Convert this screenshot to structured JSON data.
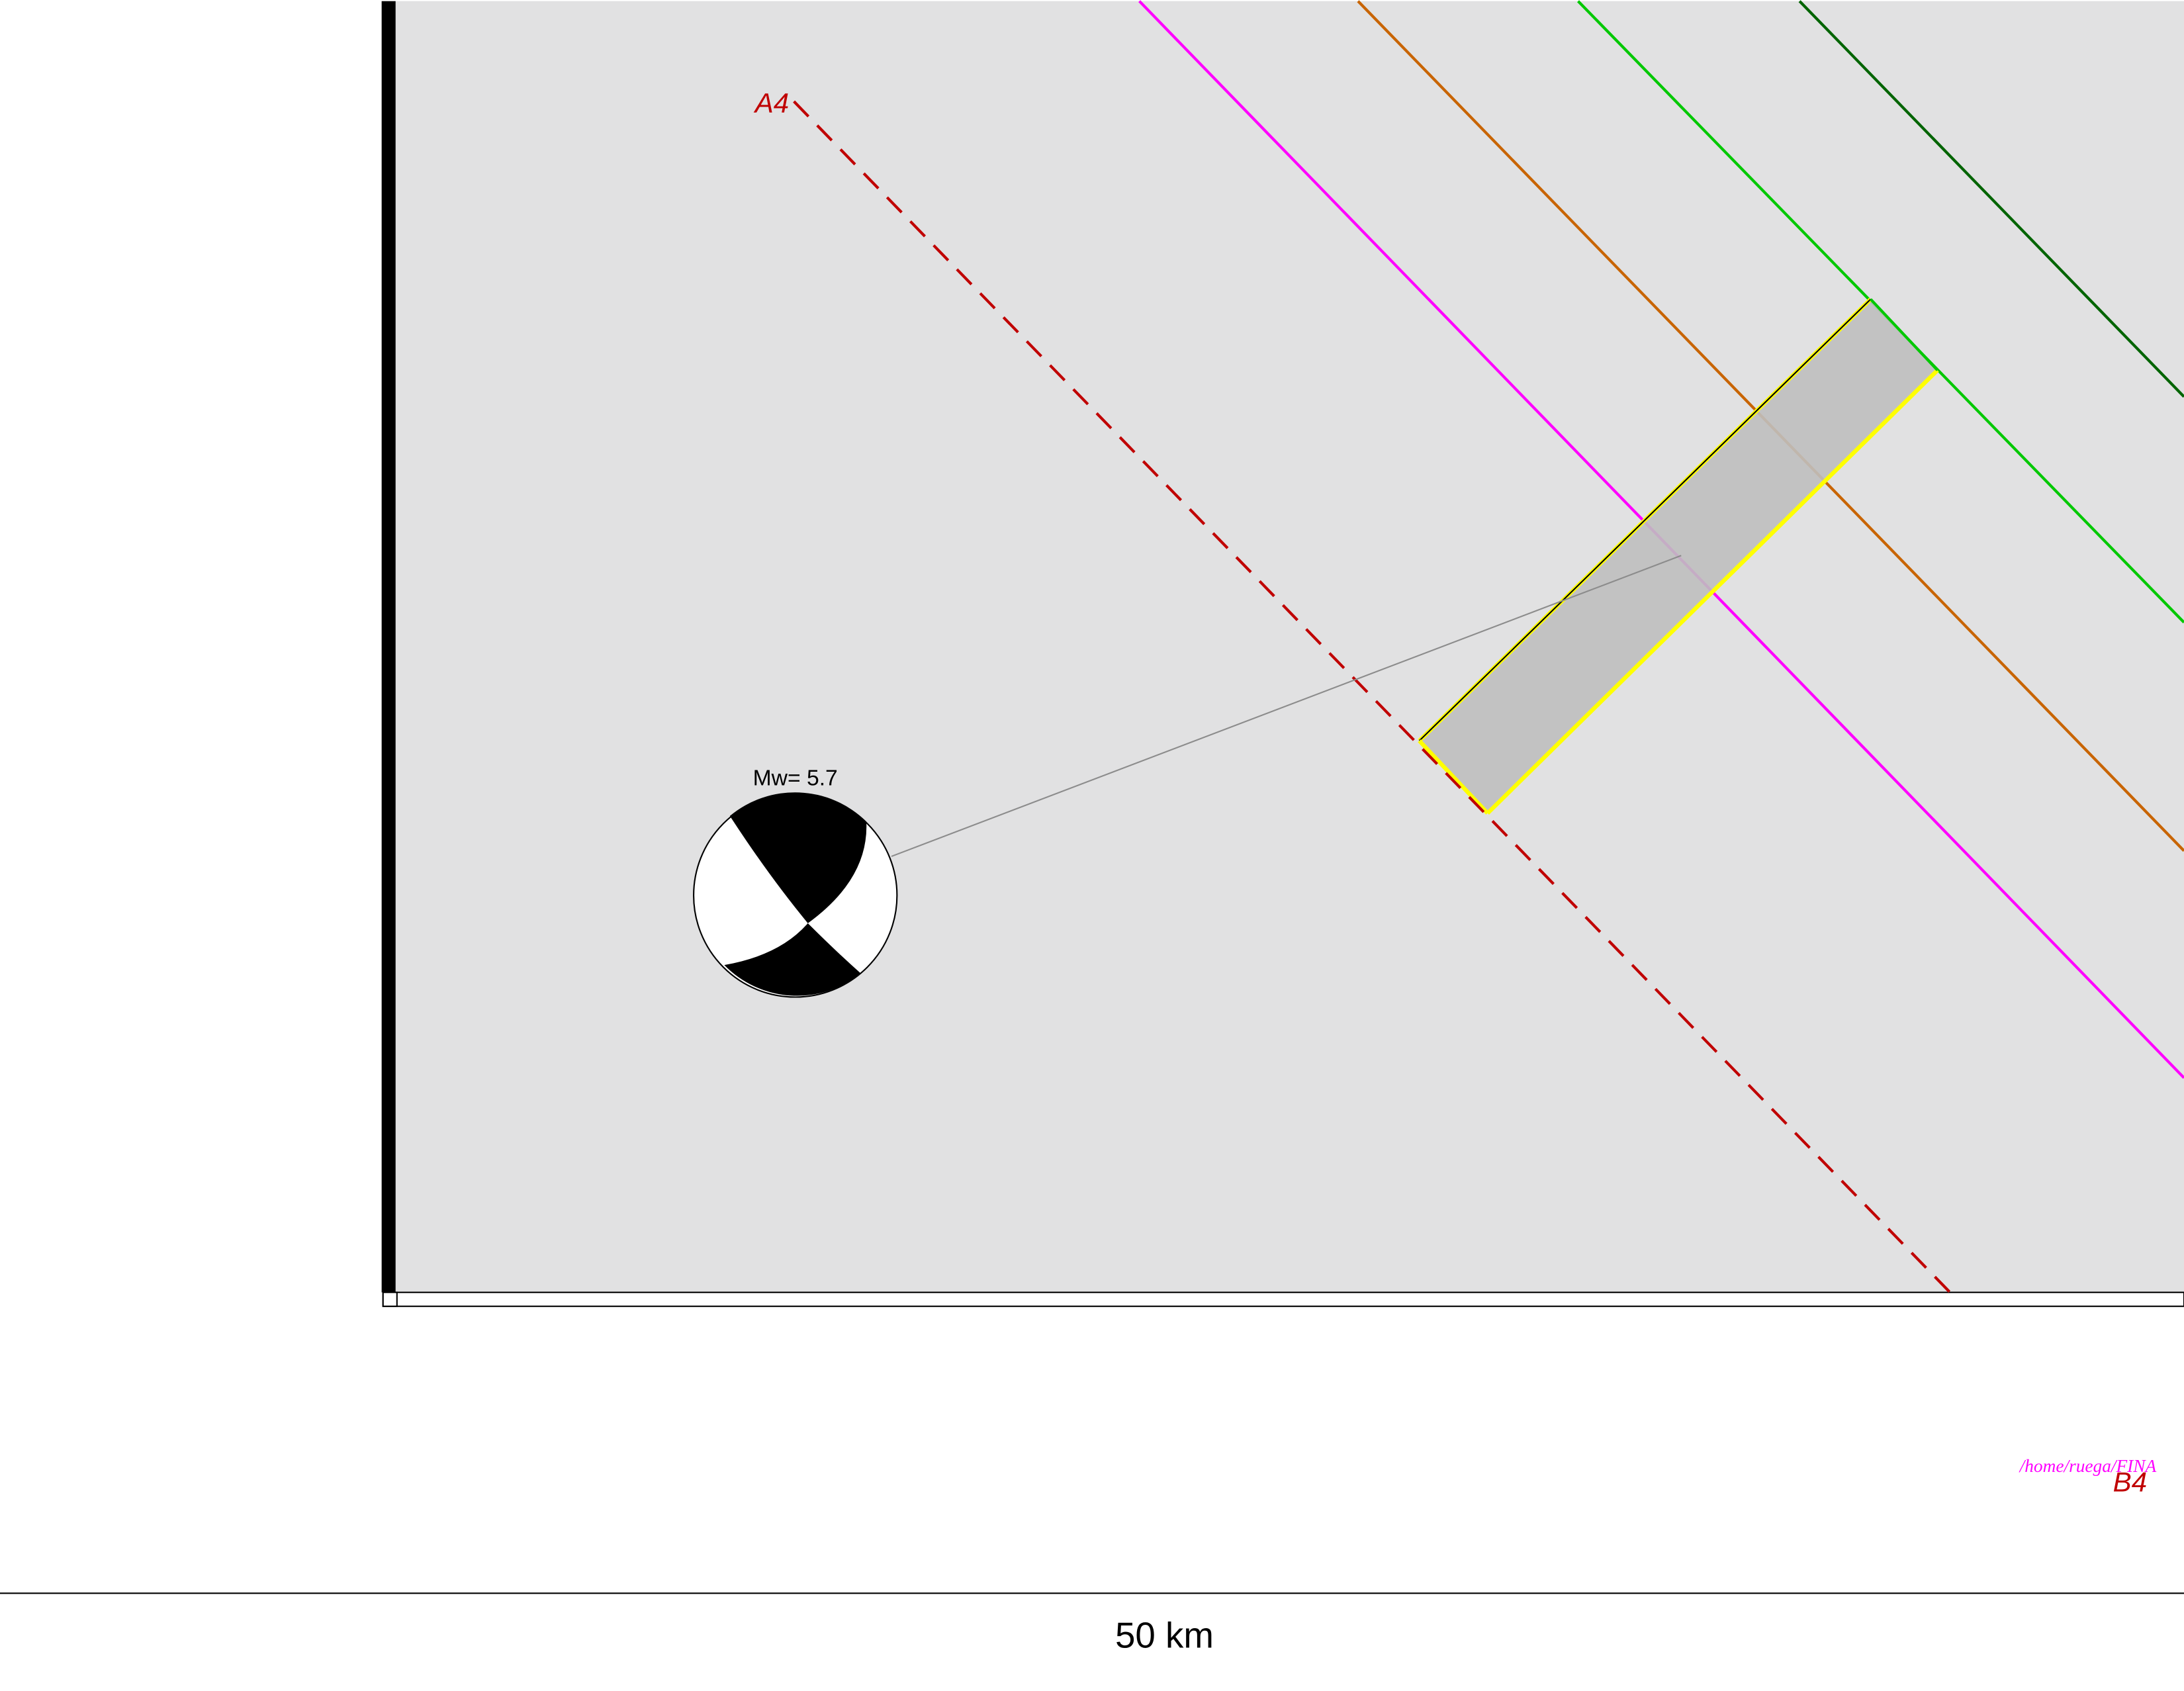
{
  "map": {
    "profile_start_label": "A4",
    "profile_end_label": "B4",
    "magnitude_label": "Mw= 5.7",
    "file_path": "/home/ruega/FINA",
    "scale_label": "50 km"
  },
  "colors": {
    "land": "#e1e1e2",
    "frame": "#000000",
    "profile": "#c00000",
    "fault_magenta": "#ff00ff",
    "fault_orange": "#c86400",
    "fault_green": "#00c800",
    "fault_darkgreen": "#006400",
    "rupture_fill": "#bfbfbf",
    "rupture_edge": "#ffff00",
    "path_text": "#ff00ff"
  },
  "beachball": {
    "type": "focal-mechanism",
    "compressional_color": "#000000",
    "dilatational_color": "#ffffff"
  }
}
